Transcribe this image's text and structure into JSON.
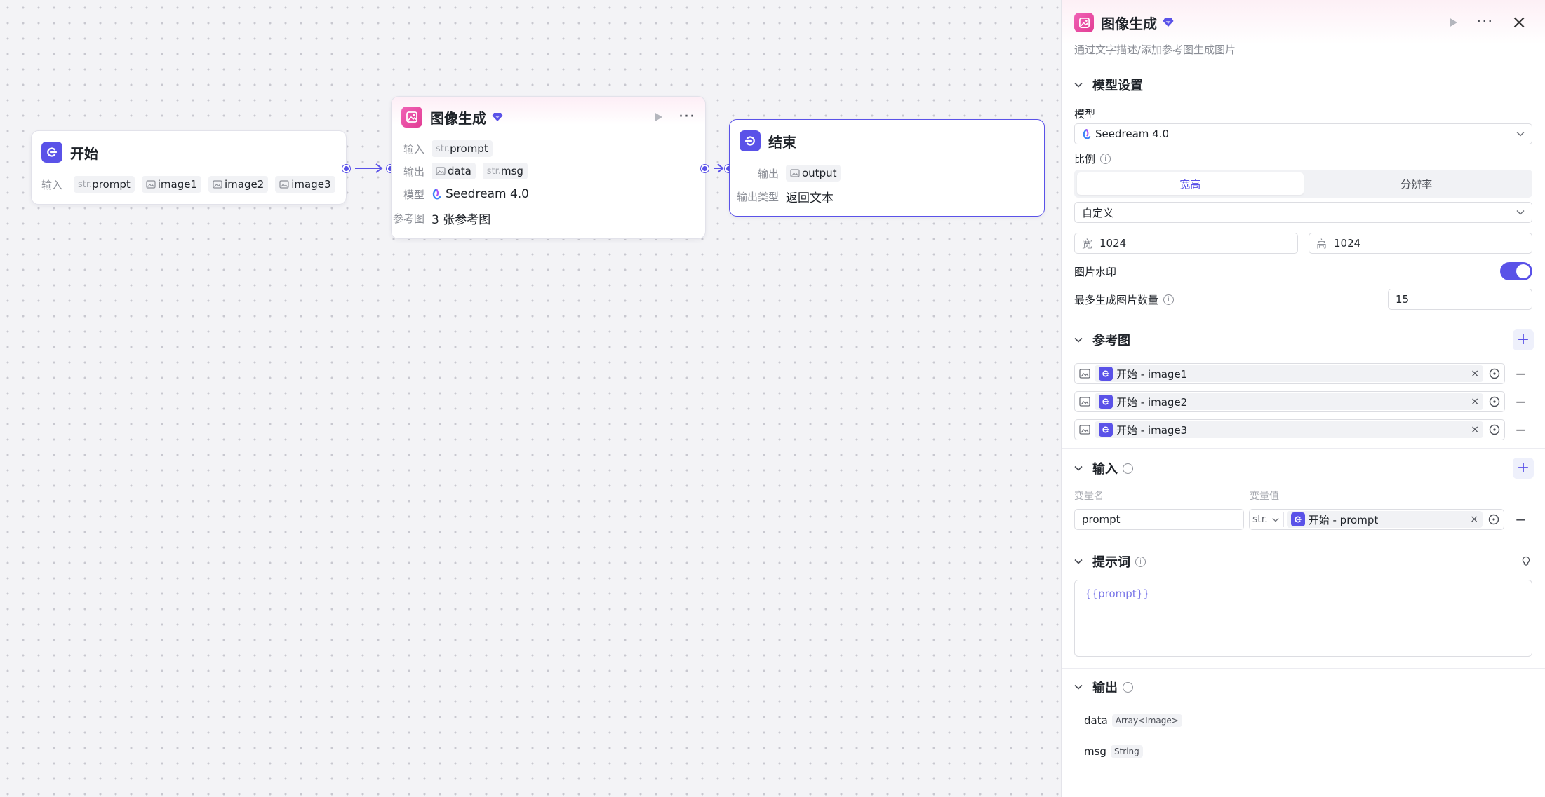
{
  "colors": {
    "accent": "#5a52e8",
    "pink": "#e23c93",
    "canvas": "#f3f3f6"
  },
  "canvas": {
    "start_node": {
      "title": "开始",
      "input_label": "输入",
      "inputs": [
        {
          "prefix": "str.",
          "name": "prompt",
          "icon": "text"
        },
        {
          "prefix": "",
          "name": "image1",
          "icon": "image-icon"
        },
        {
          "prefix": "",
          "name": "image2",
          "icon": "image-icon"
        },
        {
          "prefix": "",
          "name": "image3",
          "icon": "image-icon"
        }
      ]
    },
    "image_node": {
      "title": "图像生成",
      "input_label": "输入",
      "input": {
        "prefix": "str.",
        "name": "prompt"
      },
      "output_label": "输出",
      "outputs": [
        {
          "prefix": "",
          "name": "data",
          "icon": "image-icon"
        },
        {
          "prefix": "str.",
          "name": "msg"
        }
      ],
      "model_label": "模型",
      "model_value": "Seedream 4.0",
      "ref_label": "参考图",
      "ref_value": "3 张参考图"
    },
    "end_node": {
      "title": "结束",
      "output_label": "输出",
      "output": {
        "name": "output",
        "icon": "image-icon"
      },
      "output_type_label": "输出类型",
      "output_type_value": "返回文本"
    }
  },
  "panel": {
    "title": "图像生成",
    "subtitle": "通过文字描述/添加参考图生成图片",
    "model_settings": {
      "title": "模型设置",
      "model_label": "模型",
      "model_value": "Seedream 4.0",
      "ratio_label": "比例",
      "ratio_tabs": [
        "宽高",
        "分辨率"
      ],
      "ratio_active": "宽高",
      "preset_value": "自定义",
      "width_label": "宽",
      "width_value": "1024",
      "height_label": "高",
      "height_value": "1024",
      "watermark_label": "图片水印",
      "watermark_on": true,
      "max_images_label": "最多生成图片数量",
      "max_images_value": "15"
    },
    "reference": {
      "title": "参考图",
      "items": [
        "开始 - image1",
        "开始 - image2",
        "开始 - image3"
      ]
    },
    "inputs": {
      "title": "输入",
      "col_name": "变量名",
      "col_value": "变量值",
      "var_name": "prompt",
      "var_type": "str.",
      "var_value": "开始 - prompt"
    },
    "prompt": {
      "title": "提示词",
      "content": "{{prompt}}"
    },
    "outputs": {
      "title": "输出",
      "items": [
        {
          "name": "data",
          "type": "Array<Image>"
        },
        {
          "name": "msg",
          "type": "String"
        }
      ]
    }
  }
}
